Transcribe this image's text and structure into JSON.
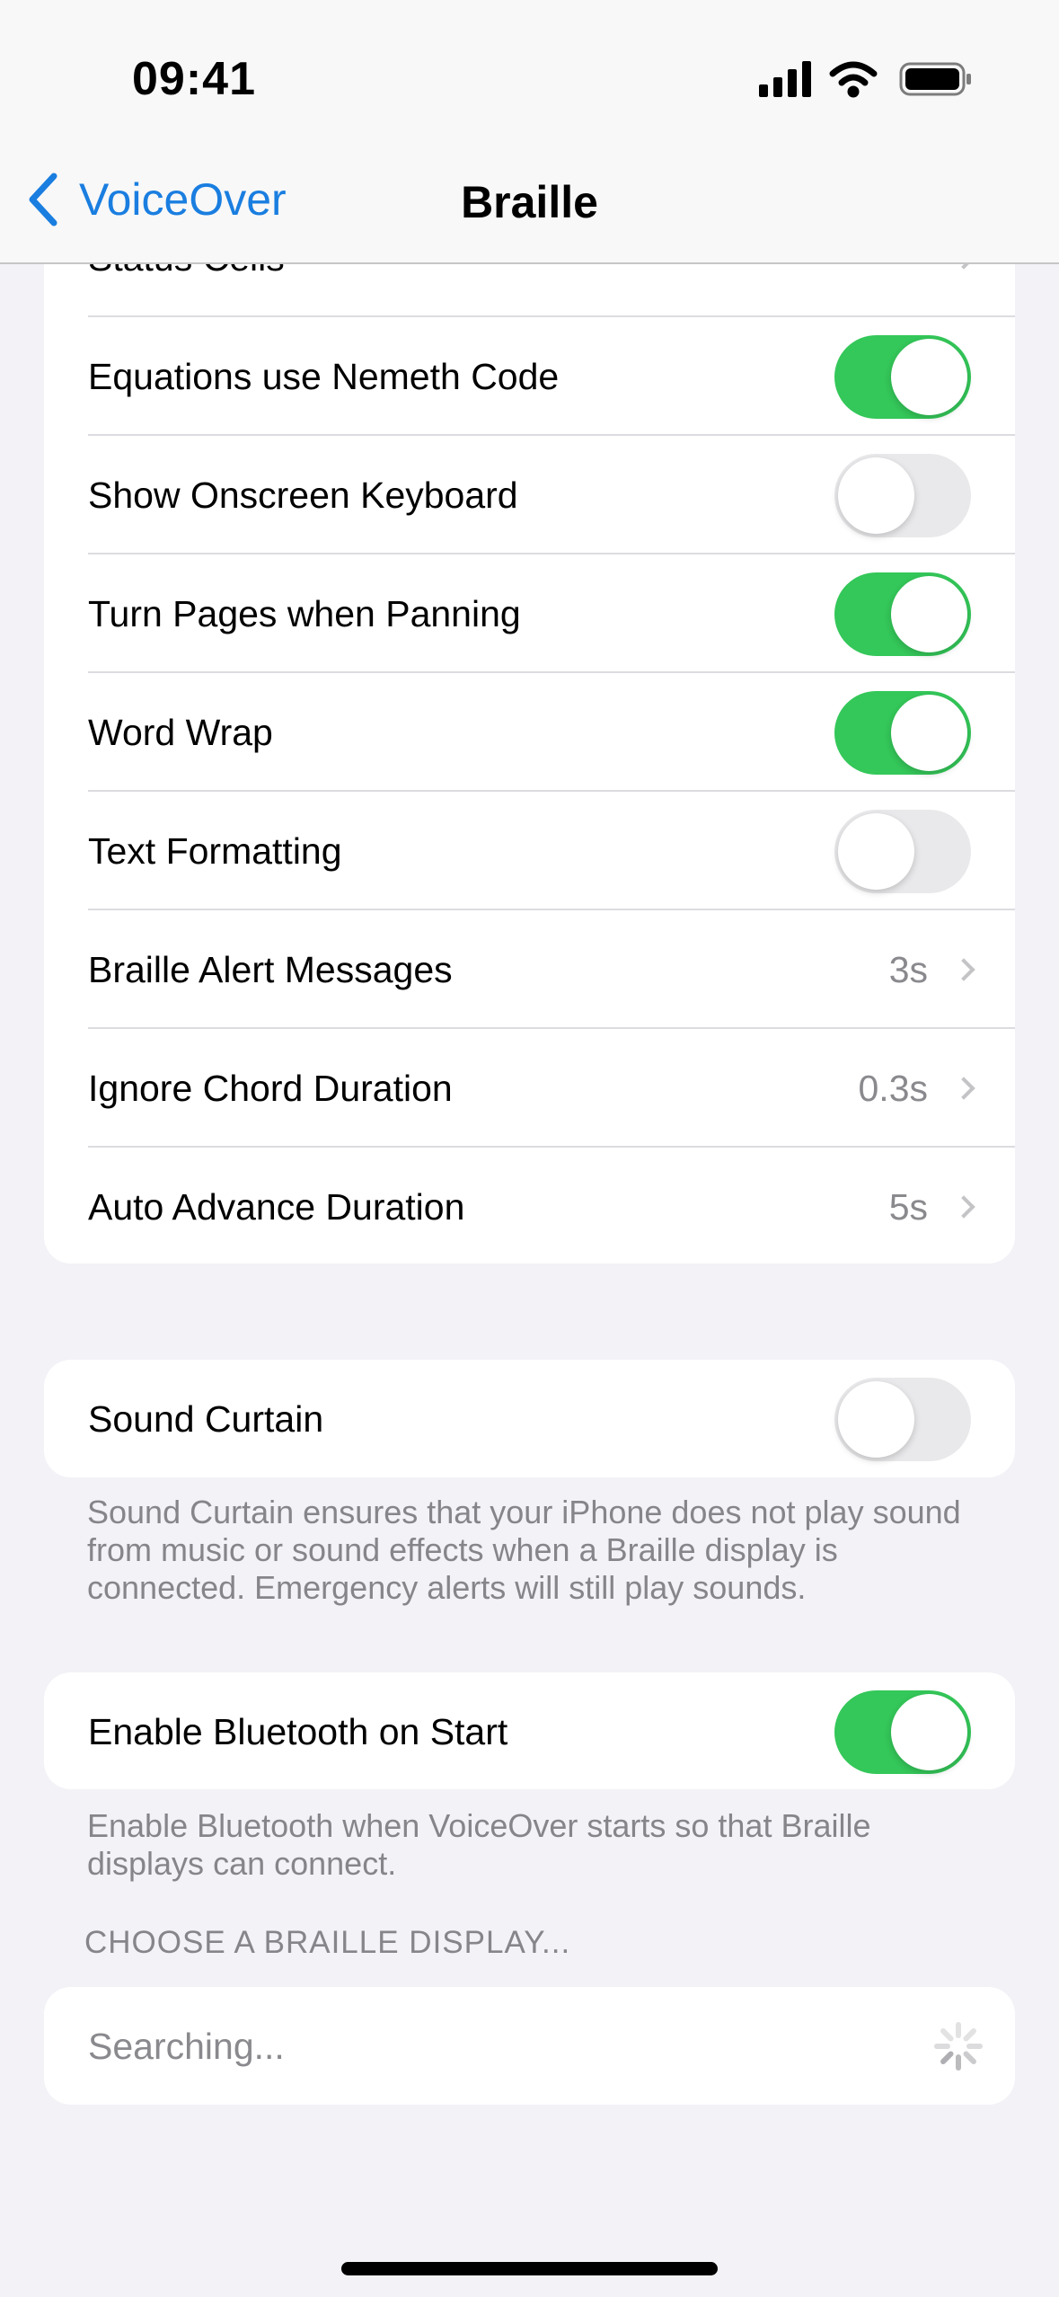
{
  "status_bar": {
    "time": "09:41",
    "icons": [
      "cellular-signal-icon",
      "wifi-icon",
      "battery-icon"
    ]
  },
  "nav": {
    "back_label": "VoiceOver",
    "title": "Braille"
  },
  "main_group": {
    "partial_row": "Status Cells",
    "rows": [
      {
        "label": "Equations use Nemeth Code",
        "type": "toggle",
        "on": true
      },
      {
        "label": "Show Onscreen Keyboard",
        "type": "toggle",
        "on": false
      },
      {
        "label": "Turn Pages when Panning",
        "type": "toggle",
        "on": true
      },
      {
        "label": "Word Wrap",
        "type": "toggle",
        "on": true
      },
      {
        "label": "Text Formatting",
        "type": "toggle",
        "on": false
      },
      {
        "label": "Braille Alert Messages",
        "type": "value",
        "value": "3s"
      },
      {
        "label": "Ignore Chord Duration",
        "type": "value",
        "value": "0.3s"
      },
      {
        "label": "Auto Advance Duration",
        "type": "value",
        "value": "5s"
      }
    ]
  },
  "sound_curtain": {
    "label": "Sound Curtain",
    "on": false,
    "footer": "Sound Curtain ensures that your iPhone does not play sound from music or sound effects when a Braille display is connected. Emergency alerts will still play sounds."
  },
  "bluetooth": {
    "label": "Enable Bluetooth on Start",
    "on": true,
    "footer": "Enable Bluetooth when VoiceOver starts so that Braille displays can connect."
  },
  "display_section": {
    "header": "CHOOSE A BRAILLE DISPLAY...",
    "searching": "Searching..."
  },
  "colors": {
    "accent": "#1a7ee0",
    "toggle_on": "#34c759",
    "background": "#f2f2f7"
  }
}
